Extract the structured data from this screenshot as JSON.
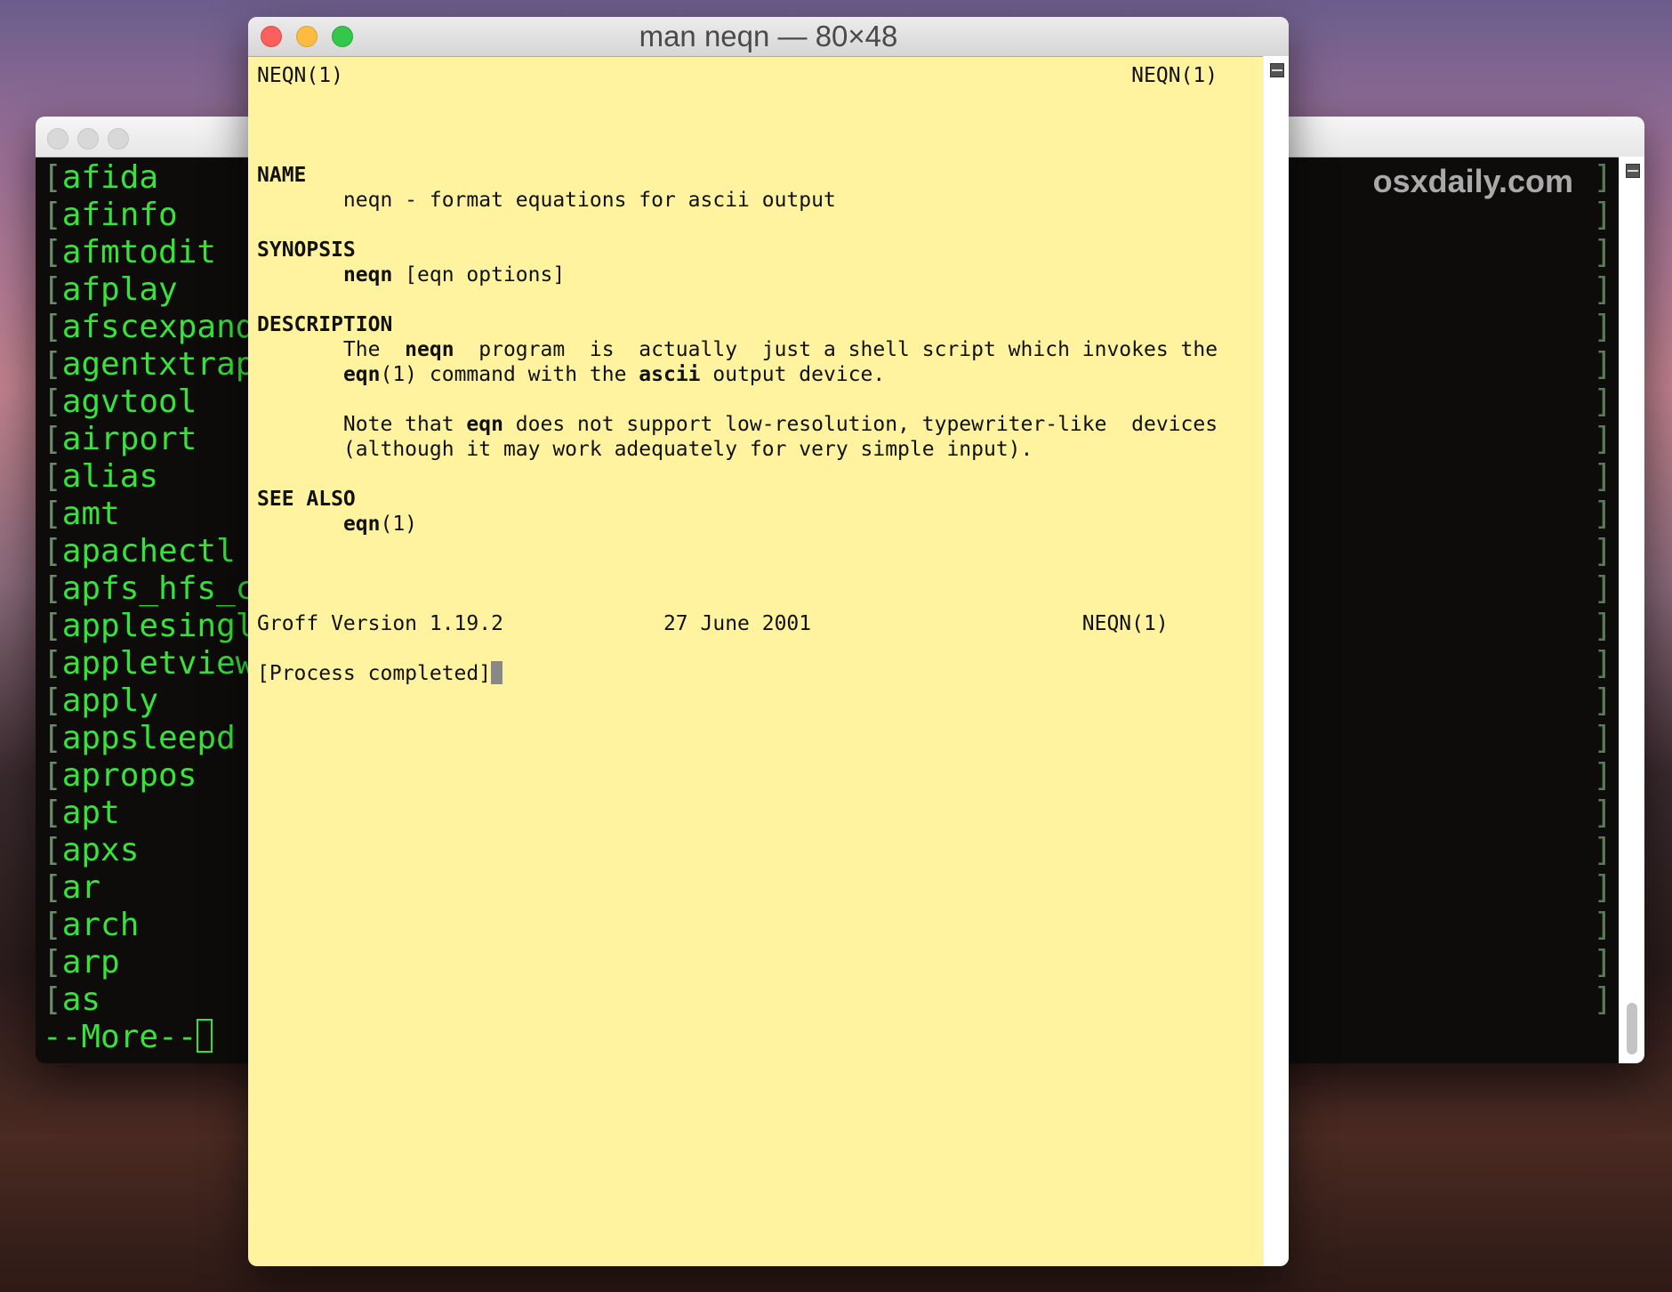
{
  "back_window": {
    "watermark": "osxdaily.com",
    "lines": [
      "afida",
      "afinfo",
      "afmtodit",
      "afplay",
      "afscexpand",
      "agentxtrap",
      "agvtool",
      "airport",
      "alias",
      "amt",
      "apachectl",
      "apfs_hfs_co",
      "applesingle",
      "appletviewe",
      "apply",
      "appsleepd",
      "apropos",
      "apt",
      "apxs",
      "ar",
      "arch",
      "arp",
      "as"
    ],
    "prompt": "--More--"
  },
  "front_window": {
    "title": "man neqn — 80×48",
    "lines": [
      {
        "row": 0,
        "segs": [
          {
            "t": "NEQN(1)                                                                NEQN(1)"
          }
        ]
      },
      {
        "row": 4,
        "segs": [
          {
            "t": "NAME",
            "b": true
          }
        ]
      },
      {
        "row": 5,
        "segs": [
          {
            "t": "       neqn - format equations for ascii output"
          }
        ]
      },
      {
        "row": 7,
        "segs": [
          {
            "t": "SYNOPSIS",
            "b": true
          }
        ]
      },
      {
        "row": 8,
        "segs": [
          {
            "t": "       "
          },
          {
            "t": "neqn",
            "b": true
          },
          {
            "t": " [eqn options]"
          }
        ]
      },
      {
        "row": 10,
        "segs": [
          {
            "t": "DESCRIPTION",
            "b": true
          }
        ]
      },
      {
        "row": 11,
        "segs": [
          {
            "t": "       The  "
          },
          {
            "t": "neqn",
            "b": true
          },
          {
            "t": "  program  is  actually  just a shell script which invokes the"
          }
        ]
      },
      {
        "row": 12,
        "segs": [
          {
            "t": "       "
          },
          {
            "t": "eqn",
            "b": true
          },
          {
            "t": "(1) command with the "
          },
          {
            "t": "ascii",
            "b": true
          },
          {
            "t": " output device."
          }
        ]
      },
      {
        "row": 14,
        "segs": [
          {
            "t": "       Note that "
          },
          {
            "t": "eqn",
            "b": true
          },
          {
            "t": " does not support low-resolution, typewriter-like  devices"
          }
        ]
      },
      {
        "row": 15,
        "segs": [
          {
            "t": "       (although it may work adequately for very simple input)."
          }
        ]
      },
      {
        "row": 17,
        "segs": [
          {
            "t": "SEE ALSO",
            "b": true
          }
        ]
      },
      {
        "row": 18,
        "segs": [
          {
            "t": "       "
          },
          {
            "t": "eqn",
            "b": true
          },
          {
            "t": "(1)"
          }
        ]
      },
      {
        "row": 22,
        "segs": [
          {
            "t": "Groff Version 1.19.2             27 June 2001                      NEQN(1)"
          }
        ]
      },
      {
        "row": 24,
        "segs": [
          {
            "t": "[Process completed]"
          }
        ],
        "cursor": true
      }
    ]
  },
  "colors": {
    "terminal_green": "#37e23a",
    "man_background": "#fff3a0",
    "close": "#fc605c",
    "minimize": "#fdbc40",
    "zoom": "#34c84a"
  }
}
